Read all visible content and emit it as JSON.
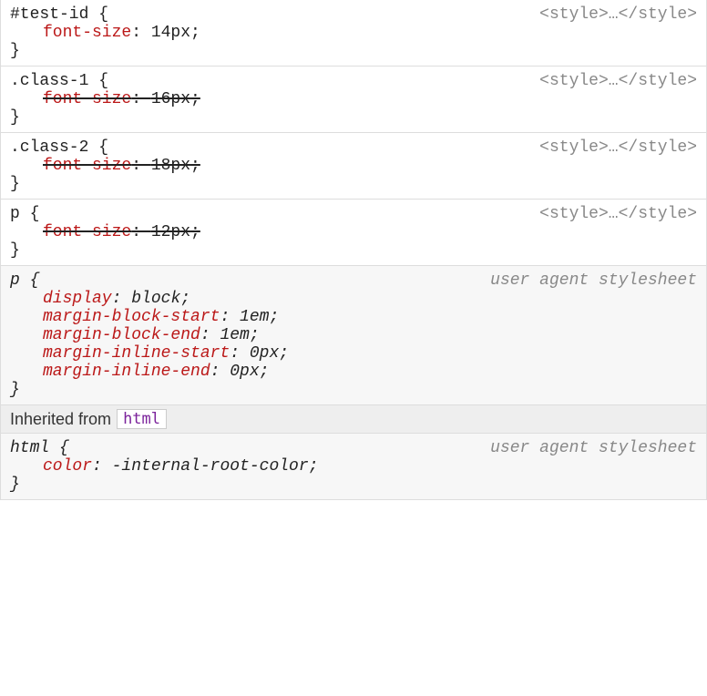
{
  "rules": [
    {
      "selector": "#test-id",
      "source": "<style>…</style>",
      "ua": false,
      "decls": [
        {
          "prop": "font-size",
          "value": "14px",
          "overridden": false
        }
      ]
    },
    {
      "selector": ".class-1",
      "source": "<style>…</style>",
      "ua": false,
      "decls": [
        {
          "prop": "font-size",
          "value": "16px",
          "overridden": true
        }
      ]
    },
    {
      "selector": ".class-2",
      "source": "<style>…</style>",
      "ua": false,
      "decls": [
        {
          "prop": "font-size",
          "value": "18px",
          "overridden": true
        }
      ]
    },
    {
      "selector": "p",
      "source": "<style>…</style>",
      "ua": false,
      "decls": [
        {
          "prop": "font-size",
          "value": "12px",
          "overridden": true
        }
      ]
    },
    {
      "selector": "p",
      "source": "user agent stylesheet",
      "ua": true,
      "decls": [
        {
          "prop": "display",
          "value": "block",
          "overridden": false
        },
        {
          "prop": "margin-block-start",
          "value": "1em",
          "overridden": false
        },
        {
          "prop": "margin-block-end",
          "value": "1em",
          "overridden": false
        },
        {
          "prop": "margin-inline-start",
          "value": "0px",
          "overridden": false
        },
        {
          "prop": "margin-inline-end",
          "value": "0px",
          "overridden": false
        }
      ]
    }
  ],
  "inherited": {
    "label_prefix": "Inherited from",
    "tag": "html",
    "rule": {
      "selector": "html",
      "source": "user agent stylesheet",
      "ua": true,
      "decls": [
        {
          "prop": "color",
          "value": "-internal-root-color",
          "overridden": false
        }
      ]
    }
  },
  "braces": {
    "open": " {",
    "close": "}"
  },
  "punct": {
    "colon": ": ",
    "semicolon": ";"
  }
}
